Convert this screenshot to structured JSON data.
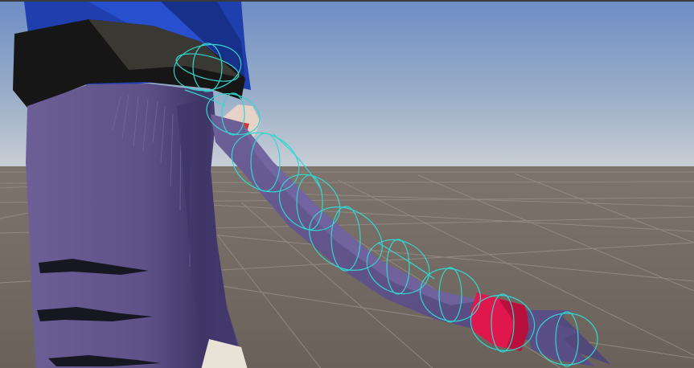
{
  "viewport": {
    "view": "scene-view",
    "gizmo_color": "#33d6d0",
    "sky_top_color": "#6f8fc7",
    "sky_horizon_color": "#c8cdd3",
    "ground_color": "#6e645c",
    "grid_color": "#8d857e",
    "fur_color": "#6a5c93",
    "fur_shadow_color": "#4b4172",
    "stripe_color": "#1a1a24",
    "shirt_color": "#1f3fae",
    "pants_color": "#1a1a1a",
    "tail_band_color": "#e0174d",
    "collider_spheres": 9
  }
}
